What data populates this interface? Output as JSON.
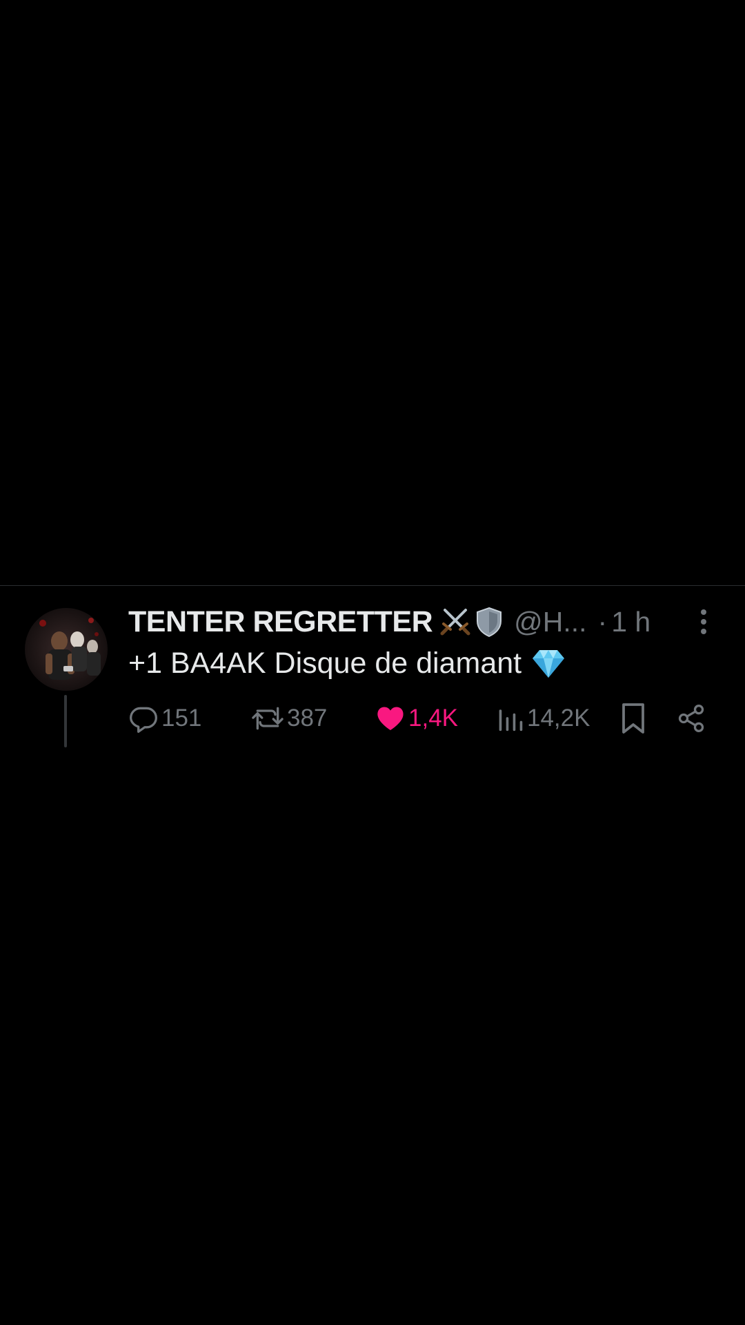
{
  "post": {
    "display_name": "TENTER REGRETTER",
    "name_emojis": [
      "crossed-swords-icon",
      "shield-icon"
    ],
    "handle": "@H...",
    "separator": "·",
    "time": "1 h",
    "text": "+1 BA4AK Disque de diamant",
    "text_emoji": "gem-icon",
    "actions": {
      "replies": "151",
      "reposts": "387",
      "likes": "1,4K",
      "views": "14,2K"
    },
    "liked": true
  },
  "colors": {
    "background": "#000000",
    "primary_text": "#e7e9ea",
    "secondary_text": "#71767b",
    "like": "#f91880",
    "divider": "#2a2d31"
  }
}
